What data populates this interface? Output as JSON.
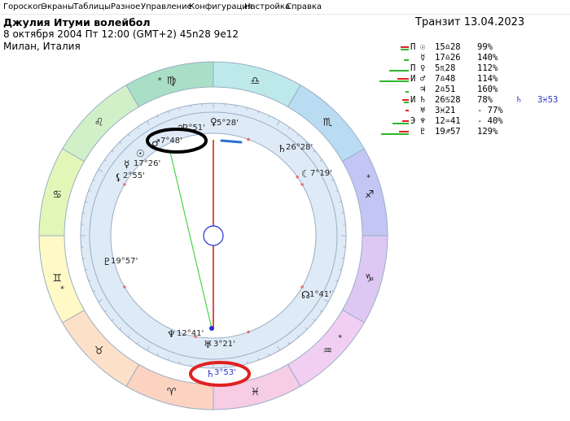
{
  "menu": [
    "Гороскоп",
    "Экраны",
    "Таблицы",
    "Разное",
    "Управление",
    "Конфигурация",
    "Настройка",
    "Справка"
  ],
  "header": {
    "name": "Джулия Итуми волейбол",
    "datetime": "8 октября 2004  Пт  12:00 (GMT+2) 45n28  9e12",
    "place": "Милан, Италия",
    "transit": "Транзит 13.04.2023"
  },
  "colors": {
    "green": "#2db82d",
    "red": "#e02020",
    "blue_text": "#2a35c9",
    "ring_fill": "#dfeaf7",
    "ring_stroke": "#9aaec4"
  },
  "transit_table": [
    {
      "indicator": "П",
      "planet": "☉",
      "position": "15♎28",
      "percent": "99%",
      "green_bar": 0.25,
      "red_bar": 0.25
    },
    {
      "indicator": "",
      "planet": "☿",
      "position": "17♎26",
      "percent": "140%",
      "green_bar": 0.15,
      "red_bar": 0
    },
    {
      "indicator": "П",
      "planet": "♀",
      "position": "5♏28",
      "percent": "112%",
      "green_bar": 0.6,
      "red_bar": 0
    },
    {
      "indicator": "И",
      "planet": "♂",
      "position": "7♎48",
      "percent": "114%",
      "green_bar": 0.9,
      "red_bar": 0.35
    },
    {
      "indicator": "",
      "planet": "♃",
      "position": "2♎51",
      "percent": "160%",
      "green_bar": 0.1,
      "red_bar": 0
    },
    {
      "indicator": "И",
      "planet": "♄",
      "position": "26♋28",
      "percent": "78%",
      "green_bar": 0.15,
      "red_bar": 0.2,
      "transit_planet": "♄",
      "transit_position": "3♓53"
    },
    {
      "indicator": "",
      "planet": "♅",
      "position": "3♓21",
      "percent": "- 77%",
      "green_bar": 0,
      "red_bar": 0.1
    },
    {
      "indicator": "Э",
      "planet": "♆",
      "position": "12♒41",
      "percent": "- 40%",
      "green_bar": 0.5,
      "red_bar": 0.2
    },
    {
      "indicator": "",
      "planet": "♇",
      "position": "19♐57",
      "percent": "129%",
      "green_bar": 0.85,
      "red_bar": 0.3
    }
  ],
  "zodiac": [
    {
      "glyph": "♈",
      "color": "#fbd3c0",
      "center_deg": 15
    },
    {
      "glyph": "♉",
      "color": "#fde0c8",
      "center_deg": 45
    },
    {
      "glyph": "♊",
      "color": "#fff9c6",
      "center_deg": 75
    },
    {
      "glyph": "♋",
      "color": "#e2f7b7",
      "center_deg": 105
    },
    {
      "glyph": "♌",
      "color": "#d2f0c8",
      "center_deg": 135
    },
    {
      "glyph": "♍",
      "color": "#a9dfc6",
      "center_deg": 165
    },
    {
      "glyph": "♎",
      "color": "#bde9ea",
      "center_deg": 195
    },
    {
      "glyph": "♏",
      "color": "#b9dcf3",
      "center_deg": 225
    },
    {
      "glyph": "♐",
      "color": "#c3c6f4",
      "center_deg": 255
    },
    {
      "glyph": "♑",
      "color": "#dcc8f3",
      "center_deg": 285
    },
    {
      "glyph": "♒",
      "color": "#f1cff3",
      "center_deg": 315
    },
    {
      "glyph": "♓",
      "color": "#f6cde5",
      "center_deg": 345
    }
  ],
  "natal_planets": [
    {
      "glyph": "♂",
      "label": "7°48'"
    },
    {
      "glyph": "♃",
      "label": "2°51'"
    },
    {
      "glyph": "♀",
      "label": "5°28'"
    },
    {
      "glyph": "☉",
      "label": ""
    },
    {
      "glyph": "☿",
      "label": "17°26'"
    },
    {
      "glyph": "⚸",
      "label": "2°55'"
    },
    {
      "glyph": "♄",
      "label": "26°28'"
    },
    {
      "glyph": "☾",
      "label": "7°19'"
    },
    {
      "glyph": "♇",
      "label": "19°57'"
    },
    {
      "glyph": "☊",
      "label": "1°41'"
    },
    {
      "glyph": "♆",
      "label": "12°41'"
    },
    {
      "glyph": "♅",
      "label": "3°21'"
    }
  ],
  "transit_planet": {
    "glyph": "♄",
    "label": "3°53'"
  }
}
